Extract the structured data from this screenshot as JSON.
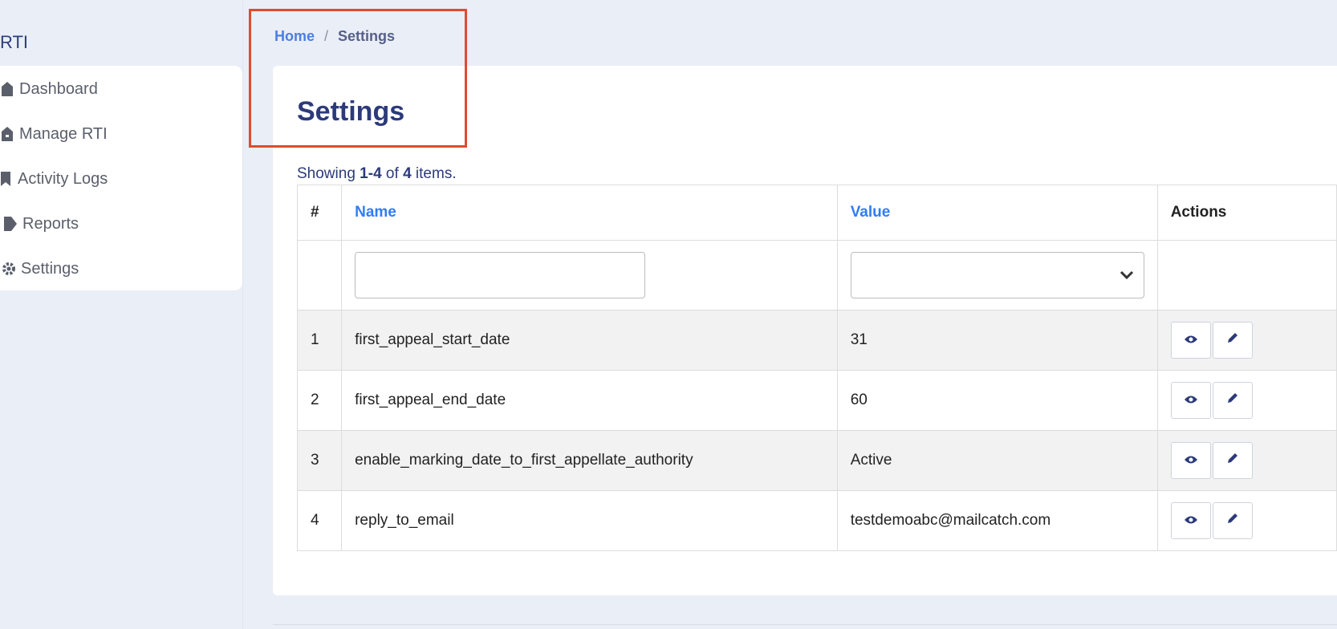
{
  "sidebar": {
    "brand": "RTI",
    "items": [
      {
        "label": "Dashboard",
        "icon": "home-icon"
      },
      {
        "label": "Manage RTI",
        "icon": "home-icon"
      },
      {
        "label": "Activity Logs",
        "icon": "bookmark-icon"
      },
      {
        "label": "Reports",
        "icon": "tag-icon"
      },
      {
        "label": "Settings",
        "icon": "gear-icon"
      }
    ]
  },
  "breadcrumb": {
    "home": "Home",
    "separator": "/",
    "current": "Settings"
  },
  "page": {
    "title": "Settings",
    "summary": {
      "prefix": "Showing",
      "range": "1-4",
      "of": "of",
      "total": "4",
      "suffix": "items."
    }
  },
  "table": {
    "headers": {
      "index": "#",
      "name": "Name",
      "value": "Value",
      "actions": "Actions"
    },
    "filters": {
      "name_value": "",
      "value_selected": ""
    },
    "rows": [
      {
        "index": "1",
        "name": "first_appeal_start_date",
        "value": "31"
      },
      {
        "index": "2",
        "name": "first_appeal_end_date",
        "value": "60"
      },
      {
        "index": "3",
        "name": "enable_marking_date_to_first_appellate_authority",
        "value": "Active"
      },
      {
        "index": "4",
        "name": "reply_to_email",
        "value": "testdemoabc@mailcatch.com"
      }
    ]
  },
  "colors": {
    "accent": "#2f7df6",
    "title": "#2c3a7a",
    "highlight": "#e04a2e"
  }
}
